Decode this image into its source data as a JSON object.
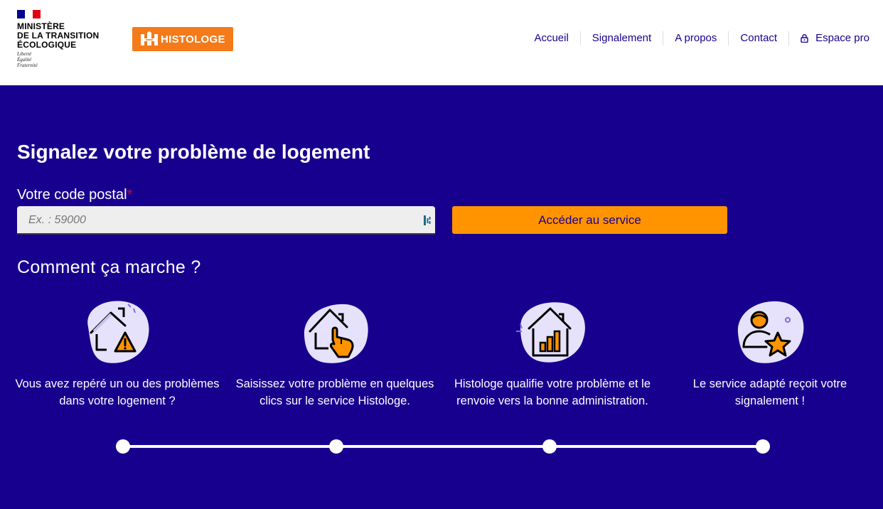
{
  "header": {
    "ministry_lines": [
      "MINISTÈRE",
      "DE LA TRANSITION",
      "ÉCOLOGIQUE"
    ],
    "motto": [
      "Liberté",
      "Égalité",
      "Fraternité"
    ],
    "logo_text": "HISTOLOGE",
    "nav": [
      {
        "label": "Accueil"
      },
      {
        "label": "Signalement"
      },
      {
        "label": "A propos"
      },
      {
        "label": "Contact"
      },
      {
        "label": "Espace pro",
        "icon": "lock-icon"
      }
    ]
  },
  "hero": {
    "title": "Signalez votre problème de logement",
    "postal_label": "Votre code postal",
    "required_mark": "*",
    "postal_placeholder": "Ex. : 59000",
    "postal_value": "",
    "submit_label": "Accéder au service"
  },
  "how": {
    "title": "Comment ça marche ?",
    "steps": [
      {
        "icon": "house-warning-icon",
        "text": "Vous avez repéré un ou des problèmes dans votre logement ?"
      },
      {
        "icon": "house-click-icon",
        "text": "Saisissez votre problème en quelques clics sur le service Histologe."
      },
      {
        "icon": "house-chart-icon",
        "text": "Histologe qualifie votre problème et le renvoie vers la bonne administration."
      },
      {
        "icon": "user-star-icon",
        "text": "Le service adapté reçoit votre signalement !"
      }
    ]
  },
  "colors": {
    "primary": "#18008f",
    "accent": "#ff9400",
    "logo": "#f47a1a",
    "required": "#e1000f"
  }
}
